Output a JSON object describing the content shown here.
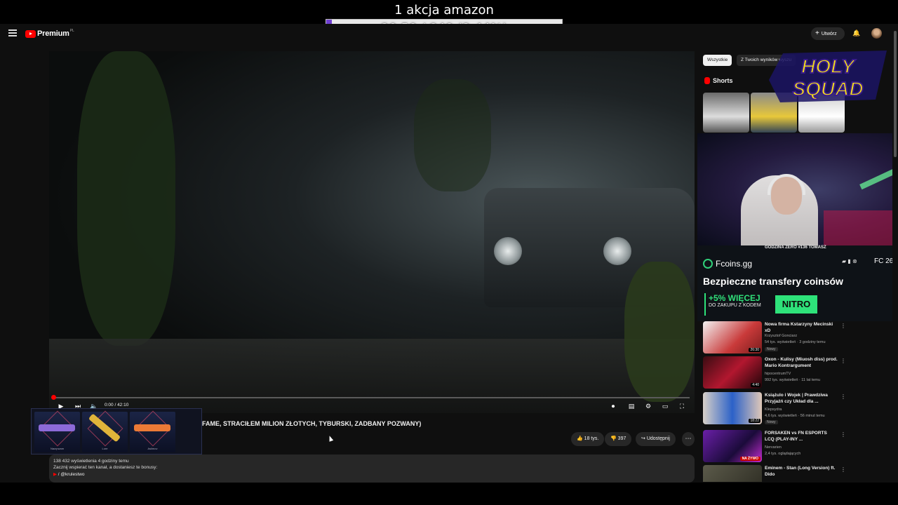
{
  "overlay": {
    "goal_title": "1 akcja amazon",
    "goal_text": "20.50 / 840 (2.44%)",
    "goal_progress": 0.0244
  },
  "header": {
    "brand": "Premium",
    "region": "PL",
    "create_label": "Utwórz"
  },
  "player": {
    "time": "0:00 / 42:10"
  },
  "inventory": {
    "items": [
      {
        "label": "Nacrpwam"
      },
      {
        "label": "Lore"
      },
      {
        "label": "Asiimov"
      }
    ]
  },
  "video": {
    "title": "FAME, STRACIŁEM MILION ZŁOTYCH, TYBURSKI, ZADBANY POZWANY)",
    "likes": "18 tys.",
    "dislikes": "397",
    "share_label": "Udostępnij",
    "views": "138 432 wyświetlenia  4 godziny temu",
    "desc_line": "Zacznij wspierać ten kanał, a dostaniesz te bonusy:",
    "desc_link": " / @krulestwo"
  },
  "sidebar": {
    "chips": [
      "Wszystkie",
      "Z Twoich wyników wyszu"
    ],
    "shorts_label": "Shorts",
    "ad": {
      "small_title": "GODZINA ZERO #136 TOMASZ",
      "brand": "Fcoins.gg",
      "fc": "FC 26",
      "headline": "Bezpieczne transfery coinsów",
      "bonus_main": "+5% WIĘCEJ",
      "bonus_sub": "DO ZAKUPU Z KODEM",
      "code": "NITRO"
    },
    "recs": [
      {
        "title": "Nowa firma Kstarzyny Mecinski xD",
        "channel": "Krzysztof Gonciarz",
        "meta": "54 tys. wyświetleń · 3 godziny temu",
        "badge": "Nowy",
        "duration": "26:30"
      },
      {
        "title": "Oxon - Kulisy (Miuosh diss) prod. Mario Kontrargument",
        "channel": "hipocentrumTV",
        "meta": "992 tys. wyświetleń · 11 lat temu",
        "badge": "",
        "duration": "4:40"
      },
      {
        "title": "Książulo i Wojek | Prawdziwa Przyjaźń czy Układ dla ...",
        "channel": "Klepsydra",
        "meta": "4,6 tys. wyświetleń · 56 minut temu",
        "badge": "Nowy",
        "duration": "18:22"
      },
      {
        "title": "FORSAKEN vs FN ESPORTS LCQ (PLAY-INY ...",
        "channel": "Nervarien",
        "meta": "2,4 tys. oglądających",
        "badge": "",
        "live": "NA ŻYWO"
      },
      {
        "title": "Eminem - Stan (Long Version) ft. Dido",
        "channel": "",
        "meta": "",
        "badge": "",
        "duration": ""
      }
    ]
  }
}
